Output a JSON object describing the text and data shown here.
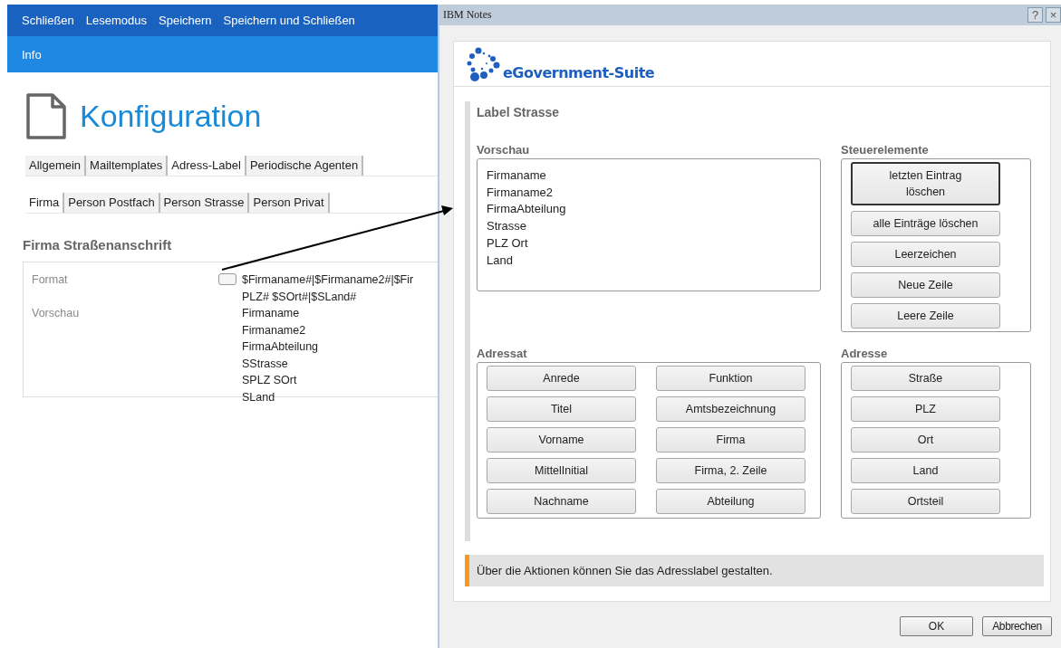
{
  "toolbar": {
    "actions": [
      "Schließen",
      "Lesemodus",
      "Speichern",
      "Speichern und Schließen"
    ]
  },
  "ribbon": {
    "tabs": [
      "Info"
    ]
  },
  "document": {
    "title": "Konfiguration",
    "tabs": [
      {
        "label": "Allgemein",
        "selected": false
      },
      {
        "label": "Mailtemplates",
        "selected": false
      },
      {
        "label": "Adress-Label",
        "selected": true
      },
      {
        "label": "Periodische Agenten",
        "selected": false
      }
    ],
    "subtabs": [
      {
        "label": "Firma",
        "selected": true
      },
      {
        "label": "Person Postfach",
        "selected": false
      },
      {
        "label": "Person Strasse",
        "selected": false
      },
      {
        "label": "Person Privat",
        "selected": false
      }
    ],
    "section_title": "Firma Straßenanschrift",
    "fields": [
      {
        "label": "Format",
        "kind": "format",
        "checked": false,
        "lines": [
          "$Firmaname#|$Firmaname2#|$Fir",
          "PLZ# $SOrt#|$SLand#"
        ]
      },
      {
        "label": "Vorschau",
        "kind": "text",
        "lines": [
          "Firmaname",
          "Firmaname2",
          "FirmaAbteilung",
          "SStrasse",
          "SPLZ SOrt",
          "SLand"
        ]
      }
    ]
  },
  "dialog": {
    "title": "IBM Notes",
    "title_buttons": [
      "?",
      "×"
    ],
    "brand": "eGovernment-Suite",
    "heading": "Label Strasse",
    "preview": {
      "label": "Vorschau",
      "lines": [
        "Firmaname",
        "Firmaname2",
        "FirmaAbteilung",
        "Strasse",
        "PLZ Ort",
        "Land"
      ]
    },
    "controls": {
      "label": "Steuerelemente",
      "buttons": [
        {
          "label": "letzten Eintrag löschen",
          "focused": true
        },
        {
          "label": "alle Einträge löschen",
          "focused": false
        },
        {
          "label": "Leerzeichen",
          "focused": false
        },
        {
          "label": "Neue Zeile",
          "focused": false
        },
        {
          "label": "Leere Zeile",
          "focused": false
        }
      ]
    },
    "recipient": {
      "label": "Adressat",
      "buttons": [
        "Anrede",
        "Funktion",
        "Titel",
        "Amtsbezeichnung",
        "Vorname",
        "Firma",
        "MittelInitial",
        "Firma, 2. Zeile",
        "Nachname",
        "Abteilung"
      ]
    },
    "address": {
      "label": "Adresse",
      "buttons": [
        "Straße",
        "PLZ",
        "Ort",
        "Land",
        "Ortsteil"
      ]
    },
    "hint": "Über die Aktionen können Sie das Adresslabel gestalten.",
    "buttons": [
      "OK",
      "Abbrechen"
    ]
  }
}
